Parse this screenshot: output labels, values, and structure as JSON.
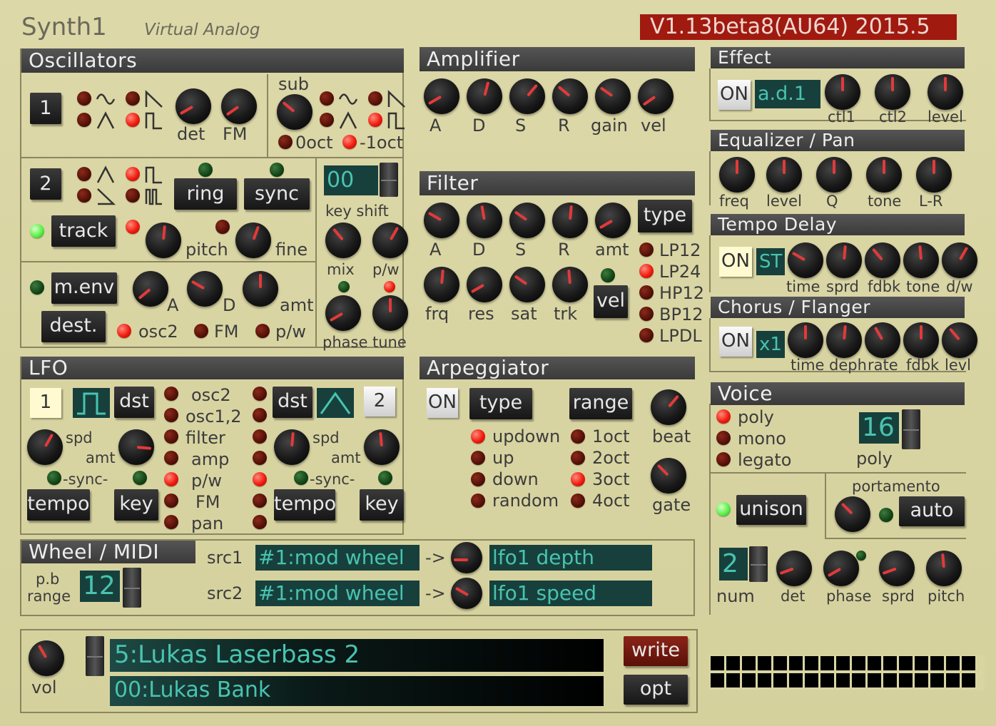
{
  "header": {
    "title": "Synth1",
    "subtitle": "Virtual Analog",
    "version": "V1.13beta8(AU64) 2015.5"
  },
  "osc": {
    "title": "Oscillators",
    "osc1": "1",
    "osc2": "2",
    "det": "det",
    "fm": "FM",
    "sub": "sub",
    "oct0": "0oct",
    "oct1": "-1oct",
    "ring": "ring",
    "sync": "sync",
    "track": "track",
    "pitch": "pitch",
    "fine": "fine",
    "keyshift_val": "00",
    "keyshift": "key shift",
    "mix": "mix",
    "pw": "p/w",
    "phase": "phase",
    "tune": "tune",
    "menv": "m.env",
    "dest": "dest.",
    "a": "A",
    "d": "D",
    "amt": "amt",
    "osc2t": "osc2",
    "fmt": "FM",
    "pwt": "p/w"
  },
  "amp": {
    "title": "Amplifier",
    "labels": [
      "A",
      "D",
      "S",
      "R",
      "gain",
      "vel"
    ]
  },
  "filter": {
    "title": "Filter",
    "labels1": [
      "A",
      "D",
      "S",
      "R",
      "amt"
    ],
    "labels2": [
      "frq",
      "res",
      "sat",
      "trk"
    ],
    "type": "type",
    "vel": "vel",
    "types": [
      "LP12",
      "LP24",
      "HP12",
      "BP12",
      "LPDL"
    ]
  },
  "effect": {
    "title": "Effect",
    "on": "ON",
    "name": "a.d.1",
    "labels": [
      "ctl1",
      "ctl2",
      "level"
    ]
  },
  "eq": {
    "title": "Equalizer / Pan",
    "labels": [
      "freq",
      "level",
      "Q",
      "tone",
      "L-R"
    ]
  },
  "delay": {
    "title": "Tempo Delay",
    "on": "ON",
    "st": "ST",
    "labels": [
      "time",
      "sprd",
      "fdbk",
      "tone",
      "d/w"
    ]
  },
  "chorus": {
    "title": "Chorus / Flanger",
    "on": "ON",
    "x1": "x1",
    "labels": [
      "time",
      "deph",
      "rate",
      "fdbk",
      "levl"
    ]
  },
  "lfo": {
    "title": "LFO",
    "n1": "1",
    "n2": "2",
    "dst": "dst",
    "spd": "spd",
    "amt": "amt",
    "sync": "-sync-",
    "tempo": "tempo",
    "key": "key",
    "dests": [
      "osc2",
      "osc1,2",
      "filter",
      "amp",
      "p/w",
      "FM",
      "pan"
    ]
  },
  "arp": {
    "title": "Arpeggiator",
    "on": "ON",
    "type": "type",
    "range": "range",
    "beat": "beat",
    "gate": "gate",
    "modes": [
      "updown",
      "up",
      "down",
      "random"
    ],
    "octs": [
      "1oct",
      "2oct",
      "3oct",
      "4oct"
    ]
  },
  "voice": {
    "title": "Voice",
    "modes": [
      "poly",
      "mono",
      "legato"
    ],
    "poly_val": "16",
    "poly": "poly",
    "portamento": "portamento",
    "unison": "unison",
    "auto": "auto",
    "num_val": "2",
    "num": "num",
    "det": "det",
    "phase": "phase",
    "sprd": "sprd",
    "pitch": "pitch"
  },
  "wheel": {
    "title": "Wheel / MIDI",
    "pb1": "p.b",
    "pb2": "range",
    "pb_val": "12",
    "src1": "src1",
    "src2": "src2",
    "src1_val": "#1:mod wheel",
    "src2_val": "#1:mod wheel",
    "arrow": "->",
    "dst1": "lfo1 depth",
    "dst2": "lfo1 speed"
  },
  "patch": {
    "vol": "vol",
    "name": "5:Lukas Laserbass 2",
    "bank": "00:Lukas Bank",
    "write": "write",
    "opt": "opt"
  }
}
